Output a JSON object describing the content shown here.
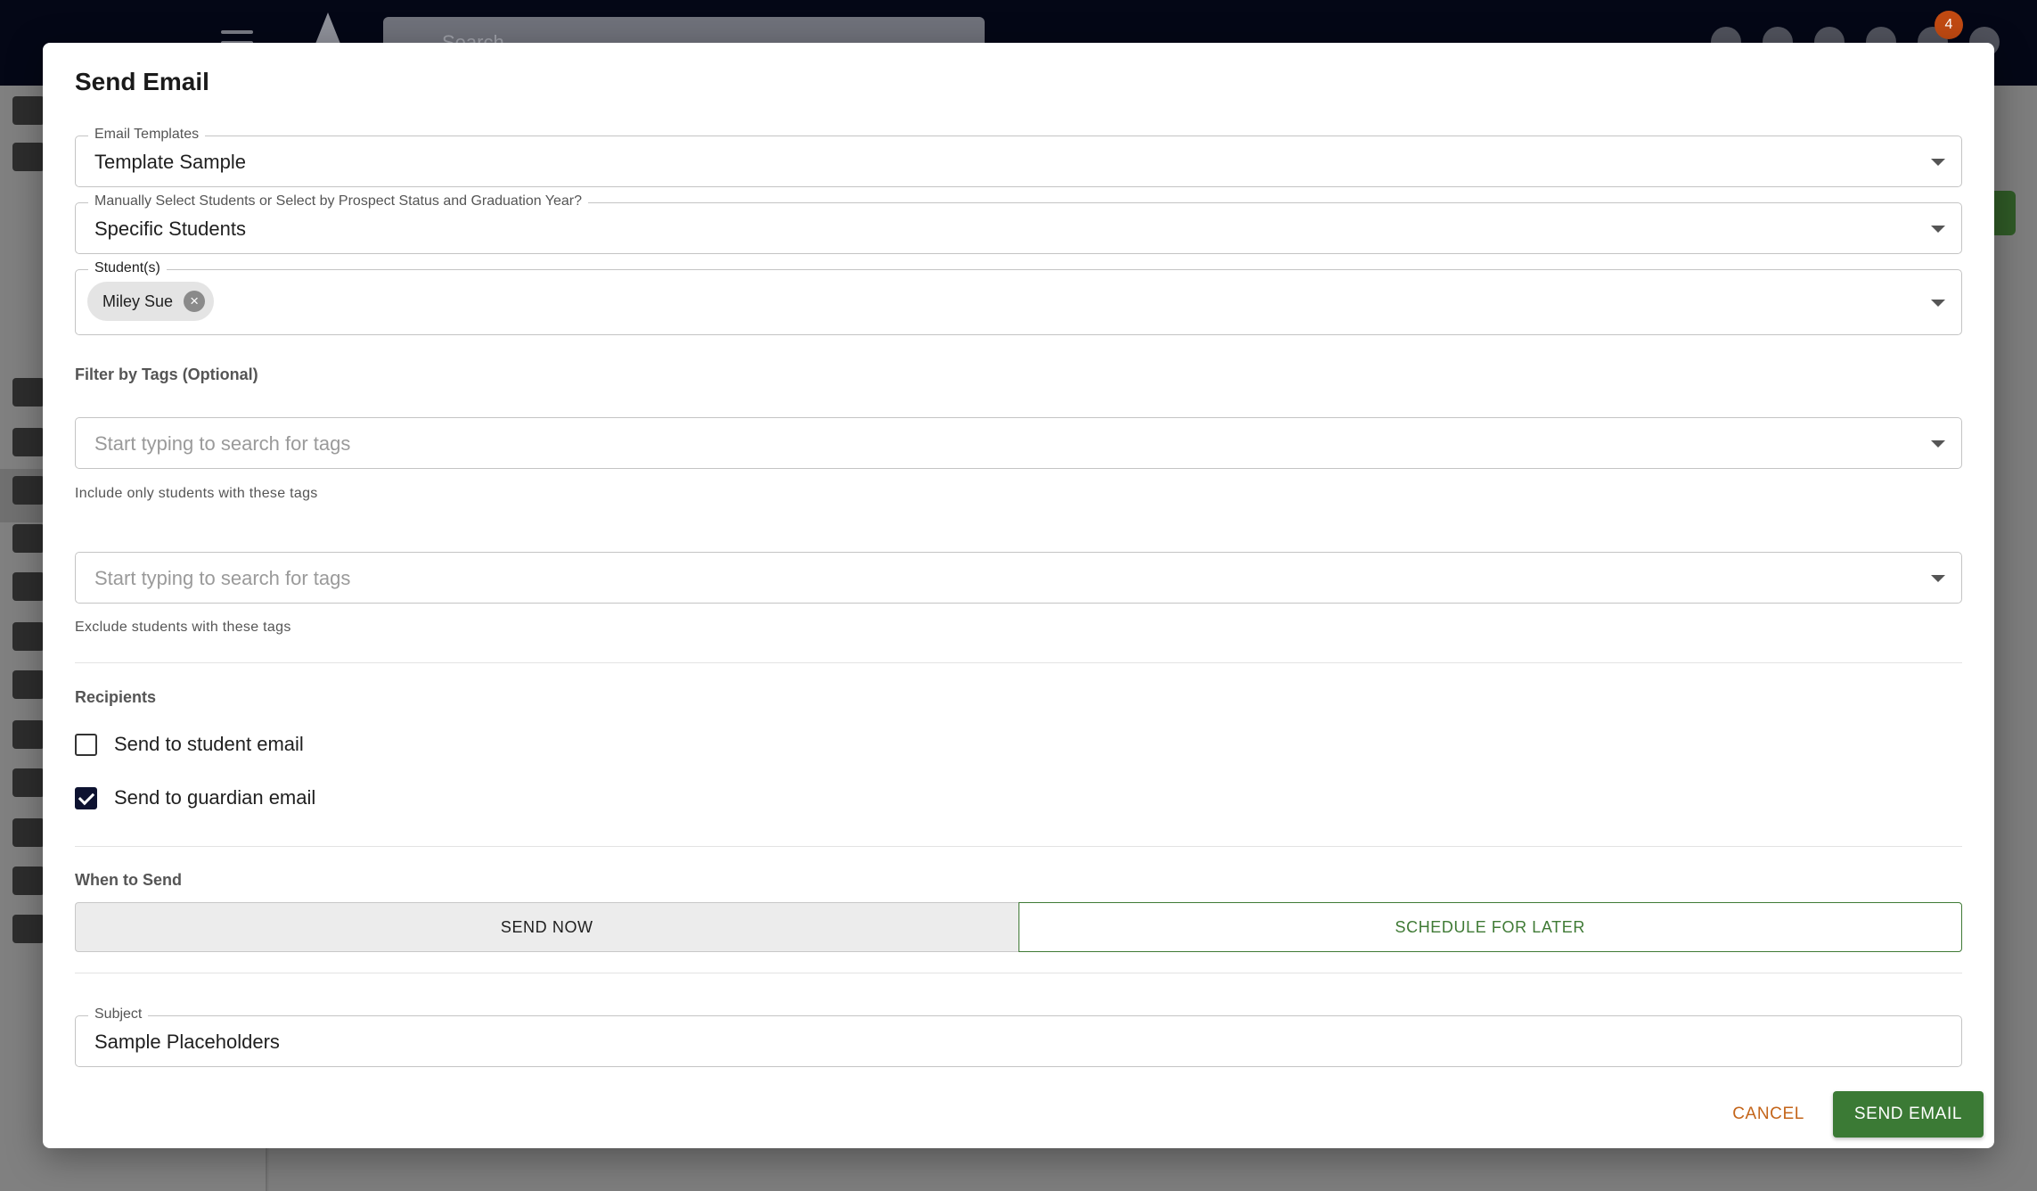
{
  "app": {
    "search_placeholder": "Search",
    "notification_count": "4"
  },
  "dialog": {
    "title": "Send Email",
    "email_templates": {
      "label": "Email Templates",
      "value": "Template Sample"
    },
    "selection_mode": {
      "label": "Manually Select Students or Select by Prospect Status and Graduation Year?",
      "value": "Specific Students"
    },
    "students": {
      "label": "Student(s)",
      "chips": [
        "Miley Sue"
      ]
    },
    "tags": {
      "section_label": "Filter by Tags (Optional)",
      "include_placeholder": "Start typing to search for tags",
      "include_helper": "Include only students with these tags",
      "exclude_placeholder": "Start typing to search for tags",
      "exclude_helper": "Exclude students with these tags"
    },
    "recipients": {
      "section_label": "Recipients",
      "student_email": {
        "label": "Send to student email",
        "checked": false
      },
      "guardian_email": {
        "label": "Send to guardian email",
        "checked": true
      }
    },
    "when_to_send": {
      "section_label": "When to Send",
      "send_now": "SEND NOW",
      "schedule_later": "SCHEDULE FOR LATER",
      "selected": "SEND NOW"
    },
    "subject": {
      "label": "Subject",
      "value": "Sample Placeholders"
    },
    "actions": {
      "cancel": "CANCEL",
      "send": "SEND EMAIL"
    }
  },
  "colors": {
    "primary_green": "#3b7a35",
    "cancel_orange": "#c4651a",
    "checkbox_navy": "#0d1230",
    "topbar": "#040716"
  }
}
